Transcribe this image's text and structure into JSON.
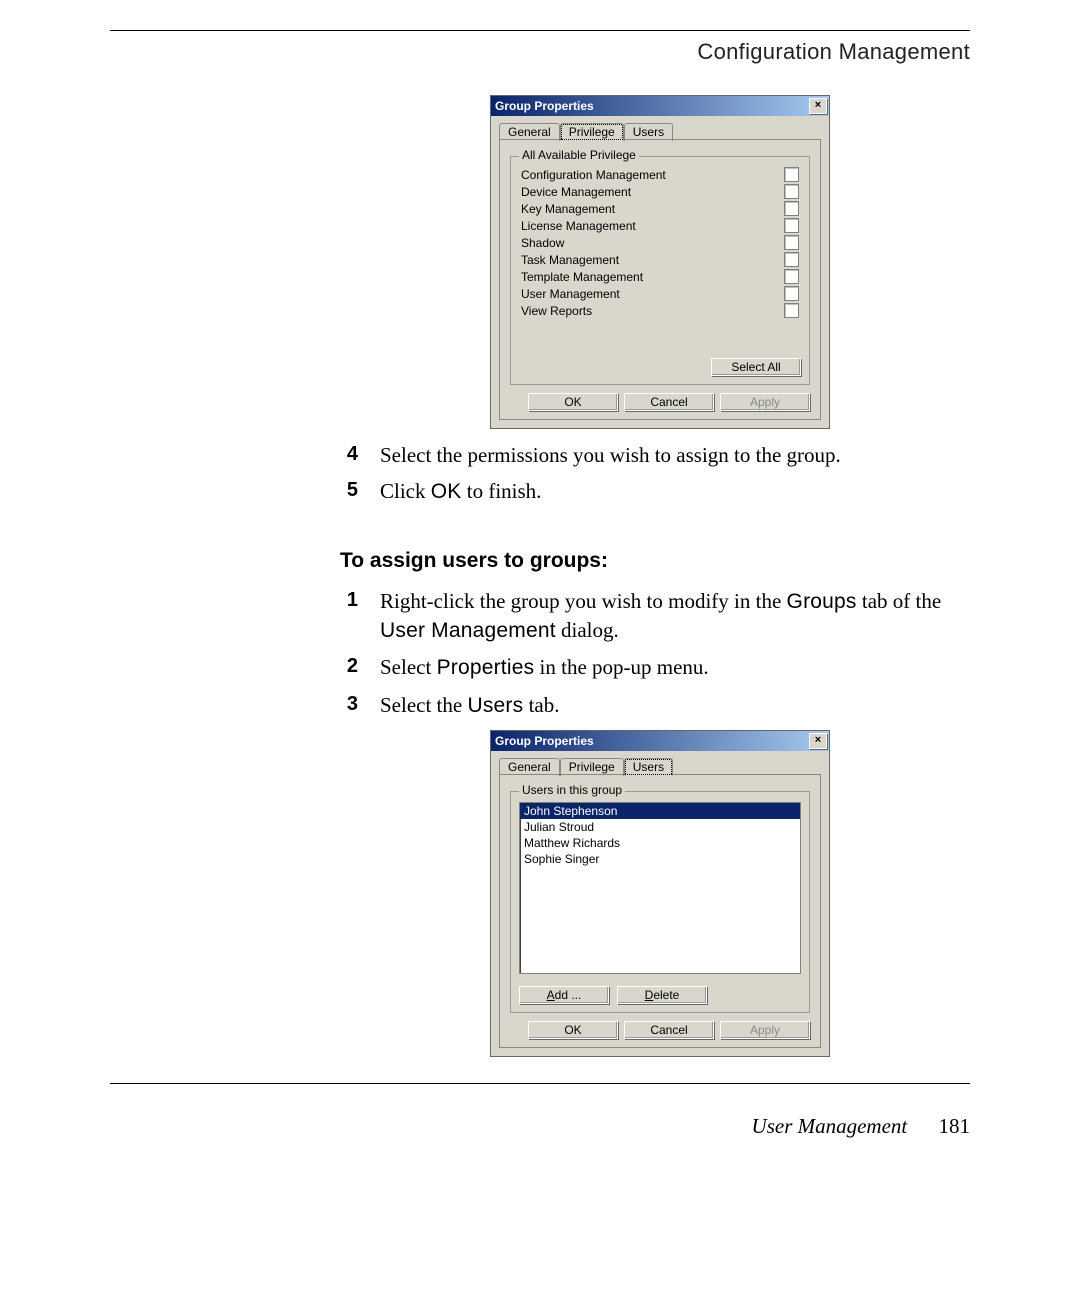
{
  "header": {
    "chapter": "Configuration Management"
  },
  "dlg1": {
    "title": "Group Properties",
    "tabs": [
      "General",
      "Privilege",
      "Users"
    ],
    "active_tab": 1,
    "groupbox_legend": "All Available Privilege",
    "privileges": [
      "Configuration Management",
      "Device Management",
      "Key Management",
      "License Management",
      "Shadow",
      "Task Management",
      "Template Management",
      "User Management",
      "View Reports"
    ],
    "select_all": "Select All",
    "ok": "OK",
    "cancel": "Cancel",
    "apply": "Apply"
  },
  "step4": {
    "num": "4",
    "text": "Select the permissions you wish to assign to the group."
  },
  "step5": {
    "num": "5",
    "pre": "Click ",
    "mono": "OK",
    "post": " to finish."
  },
  "subhead": "To assign users to groups:",
  "s1": {
    "num": "1",
    "a": "Right-click the group you wish to modify in the ",
    "m1": "Groups",
    "b": " tab of the ",
    "m2": "User Management",
    "c": " dialog."
  },
  "s2": {
    "num": "2",
    "a": "Select ",
    "m1": "Properties",
    "b": " in the pop-up menu."
  },
  "s3": {
    "num": "3",
    "a": "Select the ",
    "m1": "Users",
    "b": " tab."
  },
  "dlg2": {
    "title": "Group Properties",
    "tabs": [
      "General",
      "Privilege",
      "Users"
    ],
    "active_tab": 2,
    "groupbox_legend": "Users in this group",
    "users": [
      "John Stephenson",
      "Julian Stroud",
      "Matthew Richards",
      "Sophie Singer"
    ],
    "add": "Add ...",
    "delete": "Delete",
    "ok": "OK",
    "cancel": "Cancel",
    "apply": "Apply"
  },
  "footer": {
    "section": "User Management",
    "page": "181"
  }
}
